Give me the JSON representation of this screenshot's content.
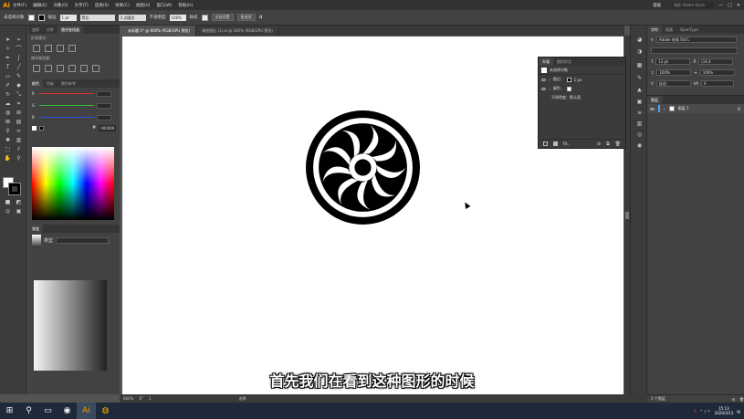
{
  "app": {
    "logo": "Ai",
    "menu": [
      "文件(F)",
      "编辑(E)",
      "对象(O)",
      "文字(T)",
      "选择(S)",
      "效果(C)",
      "视图(V)",
      "窗口(W)",
      "帮助(H)"
    ],
    "workspace": "基础",
    "search_placeholder": "搜索 Adobe Stock",
    "window_controls": [
      "—",
      "□",
      "✕"
    ]
  },
  "control_bar": {
    "selection": "未选择对象",
    "stroke_label": "描边",
    "stroke_value": "1 pt",
    "stroke_style": "等比",
    "brush": "3 点圆形",
    "opacity_label": "不透明度",
    "opacity_value": "100%",
    "style_label": "样式",
    "doc_setup": "文档设置",
    "preferences": "首选项"
  },
  "tabs": [
    {
      "label": "未标题-1* @ 600% (RGB/GPU 预览)",
      "active": true
    },
    {
      "label": "课程图形 (1).ai @ 100% (RGB/GPU 预览)",
      "active": false
    }
  ],
  "left_panel": {
    "top_tabs": [
      "变换",
      "对齐",
      "路径查找器"
    ],
    "active_top_tab": 2,
    "shape_modes_label": "形状模式：",
    "pathfinder_label": "路径查找器：",
    "color_tabs": [
      "颜色",
      "色板",
      "颜色参考"
    ],
    "channels": [
      {
        "name": "R",
        "color": "#e03030",
        "value": "0"
      },
      {
        "name": "G",
        "color": "#30c030",
        "value": "0"
      },
      {
        "name": "B",
        "color": "#3050e0",
        "value": "0"
      }
    ],
    "hex_label": "#",
    "hex_value": "000000",
    "gradient_tab": "渐变",
    "gradient_type_label": "类型"
  },
  "appearance": {
    "tabs": [
      "外观",
      "图形样式"
    ],
    "no_selection": "未选择对象",
    "stroke_label": "描边：",
    "stroke_value": "1 px",
    "fill_label": "填色：",
    "opacity_row": "不透明度：默认值",
    "fx": "fx."
  },
  "character": {
    "tabs": [
      "字符",
      "段落",
      "OpenType"
    ],
    "font_family": "Adobe 宋体 Std L",
    "font_size": "12 pt",
    "leading": "(14.4",
    "scale_h": "100%",
    "scale_v": "100%",
    "kerning": "自动",
    "tracking": "0"
  },
  "layers": {
    "tab": "图层",
    "items": [
      {
        "visible": true,
        "name": "图层 1",
        "count": "O"
      }
    ],
    "footer": "1 个图层"
  },
  "status": {
    "zoom": "600%",
    "rotation": "0°",
    "artboard": "1",
    "tool": "选择"
  },
  "subtitle": "首先我们在看到这种图形的时候",
  "taskbar": {
    "clock_time": "15:13",
    "clock_date": "2020/3/13"
  }
}
